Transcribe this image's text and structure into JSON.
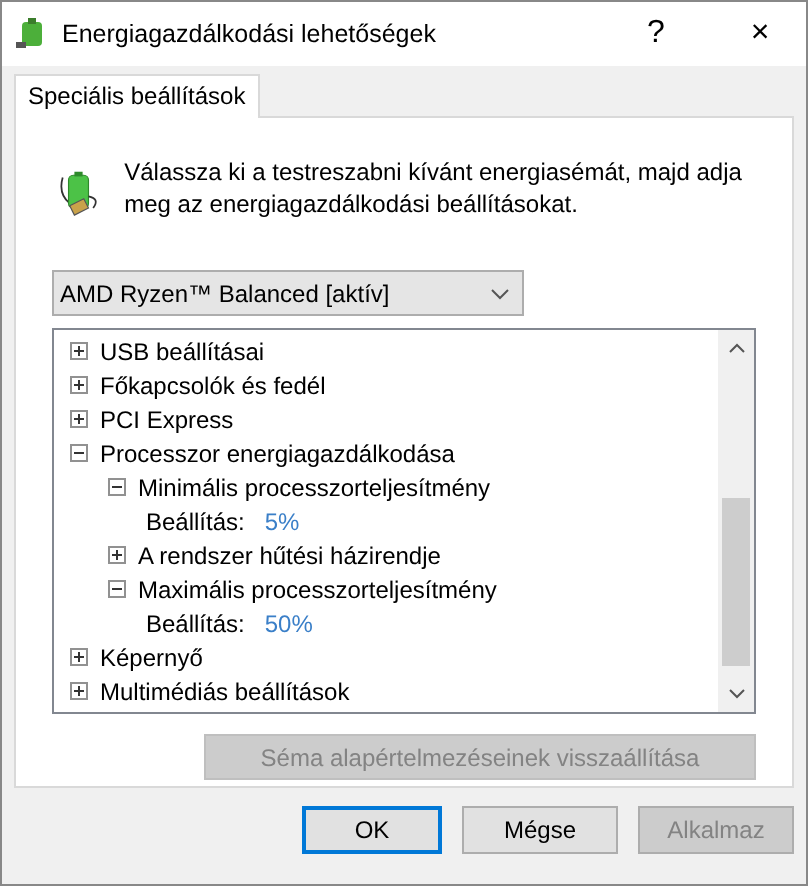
{
  "window": {
    "title": "Energiagazdálkodási lehetőségek",
    "help": "?",
    "close": "×"
  },
  "tabs": [
    {
      "label": "Speciális beállítások",
      "selected": true
    }
  ],
  "intro": "Válassza ki a testreszabni kívánt energiasémát, majd adja meg az energiagazdálkodási beállításokat.",
  "plan_dropdown": {
    "value": "AMD Ryzen™ Balanced [aktív]"
  },
  "tree": [
    {
      "kind": "group",
      "label": "USB beállításai",
      "expanded": false
    },
    {
      "kind": "group",
      "label": "Főkapcsolók és fedél",
      "expanded": false
    },
    {
      "kind": "group",
      "label": "PCI Express",
      "expanded": false
    },
    {
      "kind": "group",
      "label": "Processzor energiagazdálkodása",
      "expanded": true,
      "children": [
        {
          "kind": "group",
          "label": "Minimális processzorteljesítmény",
          "expanded": true,
          "children": [
            {
              "kind": "setting",
              "label": "Beállítás:",
              "value": "5%"
            }
          ]
        },
        {
          "kind": "group",
          "label": "A rendszer hűtési házirendje",
          "expanded": false
        },
        {
          "kind": "group",
          "label": "Maximális processzorteljesítmény",
          "expanded": true,
          "children": [
            {
              "kind": "setting",
              "label": "Beállítás:",
              "value": "50%"
            }
          ]
        }
      ]
    },
    {
      "kind": "group",
      "label": "Képernyő",
      "expanded": false
    },
    {
      "kind": "group",
      "label": "Multimédiás beállítások",
      "expanded": false
    }
  ],
  "reset_button": {
    "label": "Séma alapértelmezéseinek visszaállítása",
    "disabled": true
  },
  "buttons": [
    {
      "label": "OK",
      "default": true,
      "disabled": false
    },
    {
      "label": "Mégse",
      "default": false,
      "disabled": false
    },
    {
      "label": "Alkalmaz",
      "default": false,
      "disabled": true
    }
  ]
}
